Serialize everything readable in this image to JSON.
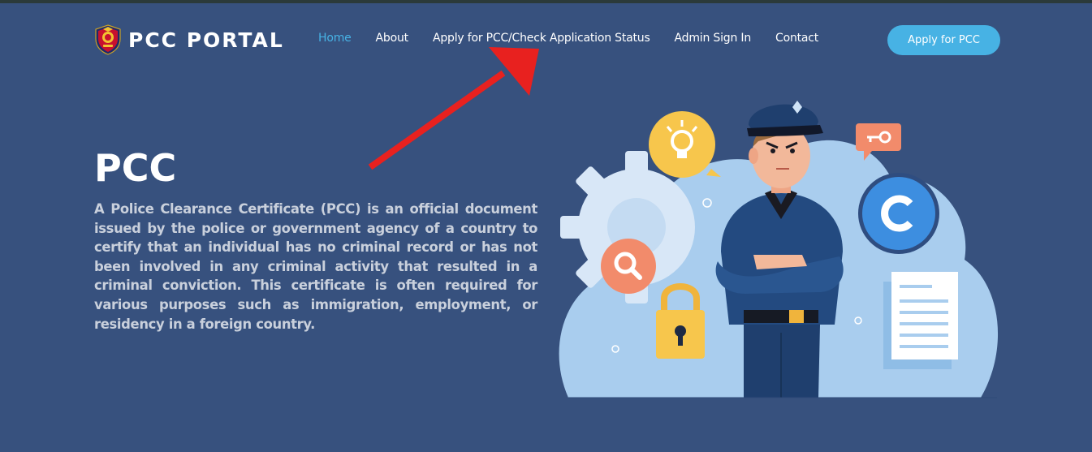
{
  "brand": {
    "name": "PCC PORTAL",
    "logo_icon": "police-emblem-icon"
  },
  "nav": {
    "items": [
      {
        "label": "Home",
        "active": true
      },
      {
        "label": "About",
        "active": false
      },
      {
        "label": "Apply for PCC/Check Application Status",
        "active": false
      },
      {
        "label": "Admin Sign In",
        "active": false
      },
      {
        "label": "Contact",
        "active": false
      }
    ],
    "cta_label": "Apply for PCC"
  },
  "hero": {
    "title": "PCC",
    "description": "A Police Clearance Certificate (PCC) is an official document issued by the police or government agency of a country to certify that an individual has no criminal record or has not been involved in any criminal activity that resulted in a criminal conviction. This certificate is often required for various purposes such as immigration, employment, or residency in a foreign country."
  },
  "annotation": {
    "icon": "red-arrow-icon",
    "color": "#e8211f"
  },
  "illustration": {
    "icons": [
      "police-officer-icon",
      "lightbulb-icon",
      "key-icon",
      "copyright-icon",
      "search-icon",
      "padlock-icon",
      "document-icon",
      "gear-icon"
    ]
  },
  "colors": {
    "background": "#37517e",
    "accent": "#47b2e4",
    "text": "#ffffff",
    "muted_text": "#c9d0dc"
  }
}
